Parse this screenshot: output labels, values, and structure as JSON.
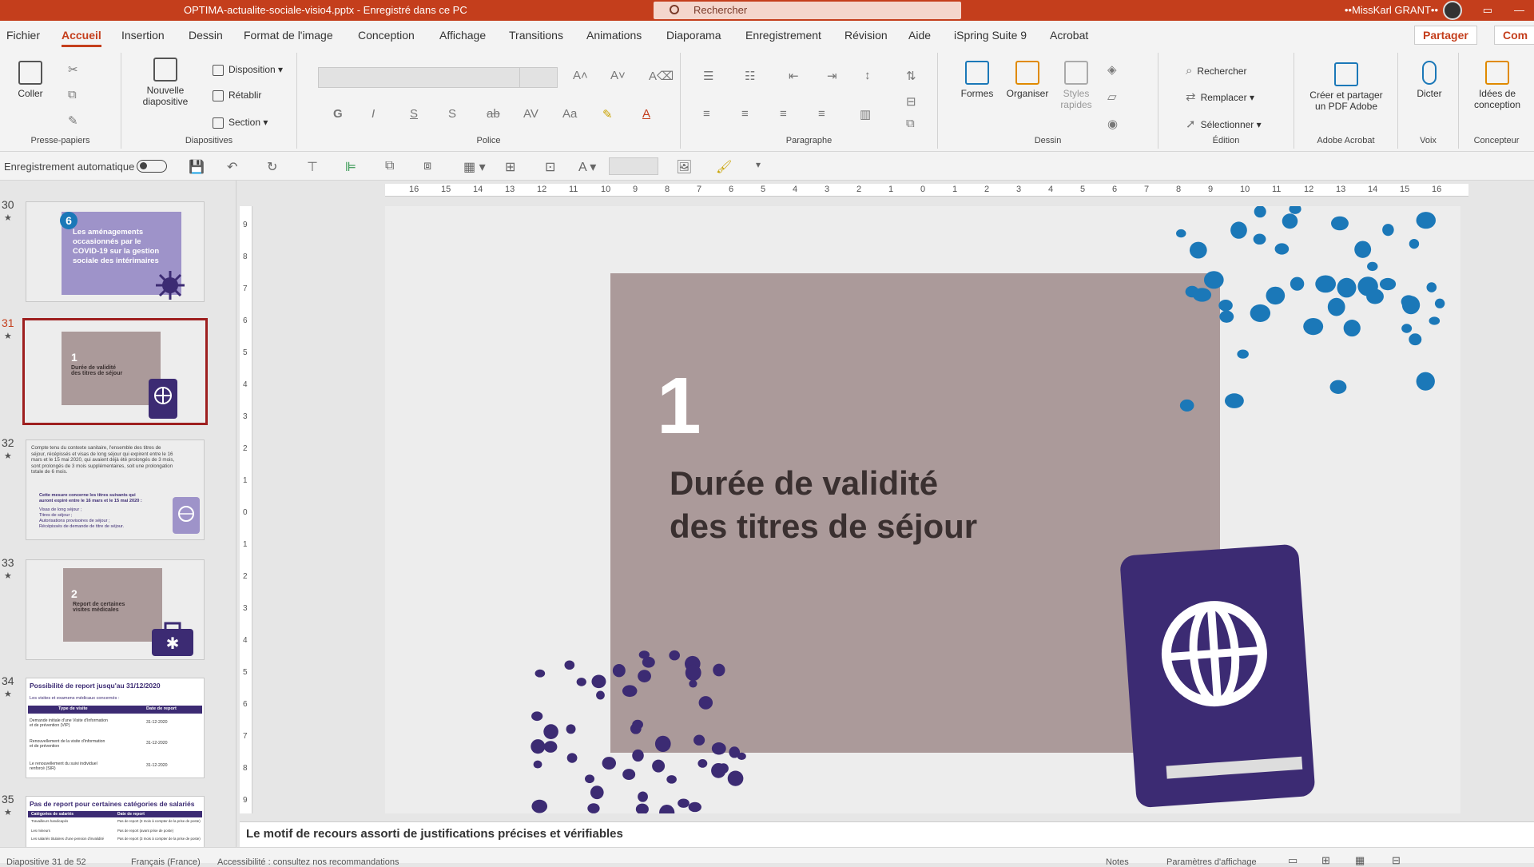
{
  "titlebar": {
    "document": "OPTIMA-actualite-sociale-visio4.pptx  -  Enregistré dans ce PC",
    "search_placeholder": "Rechercher",
    "user": "••MissKarl GRANT••"
  },
  "menu": {
    "tabs": [
      "Fichier",
      "Accueil",
      "Insertion",
      "Dessin",
      "Format de l'image",
      "Conception",
      "Affichage",
      "Transitions",
      "Animations",
      "Diaporama",
      "Enregistrement",
      "Révision",
      "Aide",
      "iSpring Suite 9",
      "Acrobat"
    ],
    "share": "Partager",
    "comments": "Com"
  },
  "ribbon": {
    "clipboard": {
      "paste": "Coller",
      "group": "Presse-papiers"
    },
    "slides": {
      "new_slide_1": "Nouvelle",
      "new_slide_2": "diapositive",
      "layout": "Disposition",
      "reset": "Rétablir",
      "section": "Section",
      "group": "Diapositives"
    },
    "font": {
      "bold": "G",
      "italic": "I",
      "underline": "S",
      "shadow": "S",
      "group": "Police"
    },
    "paragraph": {
      "group": "Paragraphe"
    },
    "drawing": {
      "shapes": "Formes",
      "arrange": "Organiser",
      "styles_1": "Styles",
      "styles_2": "rapides",
      "group": "Dessin"
    },
    "editing": {
      "find": "Rechercher",
      "replace": "Remplacer",
      "select": "Sélectionner",
      "group": "Édition"
    },
    "acrobat": {
      "create_1": "Créer et partager",
      "create_2": "un PDF Adobe",
      "group": "Adobe Acrobat"
    },
    "voice": {
      "dictate": "Dicter",
      "group": "Voix"
    },
    "designer": {
      "ideas_1": "Idées de",
      "ideas_2": "conception",
      "group": "Concepteur"
    }
  },
  "qat": {
    "autosave": "Enregistrement automatique"
  },
  "thumbnails": [
    {
      "num": "30",
      "badge": "6",
      "text": "Les aménagements occasionnés par le COVID-19 sur la gestion sociale des intérimaires"
    },
    {
      "num": "31",
      "text_num": "1",
      "text": "Durée de validité des titres de séjour",
      "selected": true
    },
    {
      "num": "32",
      "text": "Compte tenu du contexte sanitaire, l'ensemble des titres de séjour, récépissés et visas de long séjour qui expirent entre le 16 mars et le 15 mai 2020, qui avaient déjà été prolongés de 3 mois, sont prolongés de 3 mois supplémentaires, soit une prolongation totale de 6 mois."
    },
    {
      "num": "33",
      "text_num": "2",
      "text": "Report de certaines visites médicales"
    },
    {
      "num": "34",
      "text": "Possibilité de report jusqu'au 31/12/2020"
    },
    {
      "num": "35",
      "text": "Pas de report pour certaines catégories de salariés"
    }
  ],
  "thumb_details": {
    "t32_sub": "Cette mesure concerne les titres suivants qui auront expiré entre le 16 mars et le 15 mai 2020 :",
    "t32_items": [
      "Visas de long séjour ;",
      "Titres de séjour ;",
      "Autorisations provisoires de séjour ;",
      "Récépissés de demande de titre de séjour."
    ],
    "t34_sub": "Les visites et examens médicaux concernés :",
    "t34_headers": [
      "Type de visite",
      "Date de report"
    ],
    "t34_rows": [
      [
        "Demande initiale d'une Visite d'Information et de prévention (VIP)",
        "31-12-2020"
      ],
      [
        "Renouvellement de la visite d'information et de prévention",
        "31-12-2020"
      ],
      [
        "Le renouvellement du suivi individuel renforcé (SIR)",
        "31-12-2020"
      ]
    ],
    "t35_headers": [
      "Catégories de salariés",
      "Date de report"
    ],
    "t35_rows": [
      [
        "Travailleurs handicapés",
        "Pas de report (3 mois à compter de la prise de poste)"
      ],
      [
        "Les mineurs",
        "Pas de report (avant prise de poste)"
      ],
      [
        "Les salariés titulaires d'une pension d'invalidité",
        "Pas de report (3 mois à compter de la prise de poste)"
      ]
    ]
  },
  "slide": {
    "number": "1",
    "title_line1": "Durée de validité",
    "title_line2": "des titres de séjour"
  },
  "ruler": {
    "h": [
      "16",
      "15",
      "14",
      "13",
      "12",
      "11",
      "10",
      "9",
      "8",
      "7",
      "6",
      "5",
      "4",
      "3",
      "2",
      "1",
      "0",
      "1",
      "2",
      "3",
      "4",
      "5",
      "6",
      "7",
      "8",
      "9",
      "10",
      "11",
      "12",
      "13",
      "14",
      "15",
      "16"
    ],
    "v": [
      "9",
      "8",
      "7",
      "6",
      "5",
      "4",
      "3",
      "2",
      "1",
      "0",
      "1",
      "2",
      "3",
      "4",
      "5",
      "6",
      "7",
      "8",
      "9"
    ]
  },
  "notes": "Le motif de recours assorti de justifications précises et vérifiables",
  "status": {
    "slide": "Diapositive 31 de 52",
    "lang": "Français (France)",
    "access": "Accessibilité : consultez nos recommandations",
    "notes": "Notes",
    "display": "Paramètres d'affichage"
  },
  "colors": {
    "accent": "#c43e1c",
    "slide_bg": "#ab9a9a",
    "dots": "#1b78b8",
    "purple": "#3c2b73"
  }
}
